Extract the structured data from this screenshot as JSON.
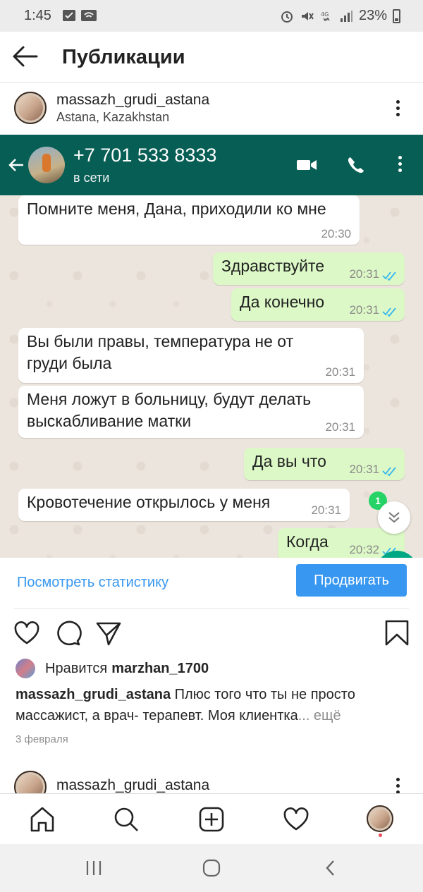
{
  "status_bar": {
    "time": "1:45",
    "battery": "23%",
    "icons": [
      "message-icon",
      "wifi-icon",
      "alarm-icon",
      "mute-icon",
      "4g-icon",
      "signal-icon",
      "battery-icon"
    ]
  },
  "header": {
    "title": "Публикации",
    "back_icon": "arrow-left-icon"
  },
  "post": {
    "username": "massazh_grudi_astana",
    "location": "Astana, Kazakhstan",
    "screenshot": {
      "contact_phone": "+7 701 533 8333",
      "presence": "в сети",
      "messages": [
        {
          "dir": "in",
          "text": "Помните меня, Дана, приходили ко мне",
          "time": "20:30"
        },
        {
          "dir": "out",
          "text": "Здравствуйте",
          "time": "20:31"
        },
        {
          "dir": "out",
          "text": "Да конечно",
          "time": "20:31"
        },
        {
          "dir": "in",
          "text": "Вы были правы, температура не от груди была",
          "time": "20:31"
        },
        {
          "dir": "in",
          "text": "Меня ложут в больницу, будут делать выскабливание матки",
          "time": "20:31"
        },
        {
          "dir": "out",
          "text": "Да вы что",
          "time": "20:31"
        },
        {
          "dir": "in",
          "text": "Кровотечение открылось у меня",
          "time": "20:31"
        },
        {
          "dir": "out",
          "text": "Когда",
          "time": "20:32"
        }
      ],
      "unread_count": "1",
      "colors": {
        "bar": "#075e54",
        "out_bubble": "#dcf8c6",
        "in_bubble": "#ffffff",
        "read_ticks": "#34b7f1"
      }
    },
    "view_stats": "Посмотреть статистику",
    "promote": "Продвигать",
    "likes_prefix": "Нравится",
    "likes_user": "marzhan_1700",
    "caption_user": "massazh_grudi_astana",
    "caption_text": " Плюс того что ты не просто массажист, а врач- терапевт. Моя клиентка",
    "caption_more": "... ещё",
    "date": "3 февраля"
  },
  "next_post": {
    "username": "massazh_grudi_astana"
  },
  "tabbar": {
    "items": [
      "home-icon",
      "search-icon",
      "add-post-icon",
      "activity-heart-icon",
      "profile-avatar"
    ]
  },
  "colors": {
    "accent": "#3897f0"
  }
}
